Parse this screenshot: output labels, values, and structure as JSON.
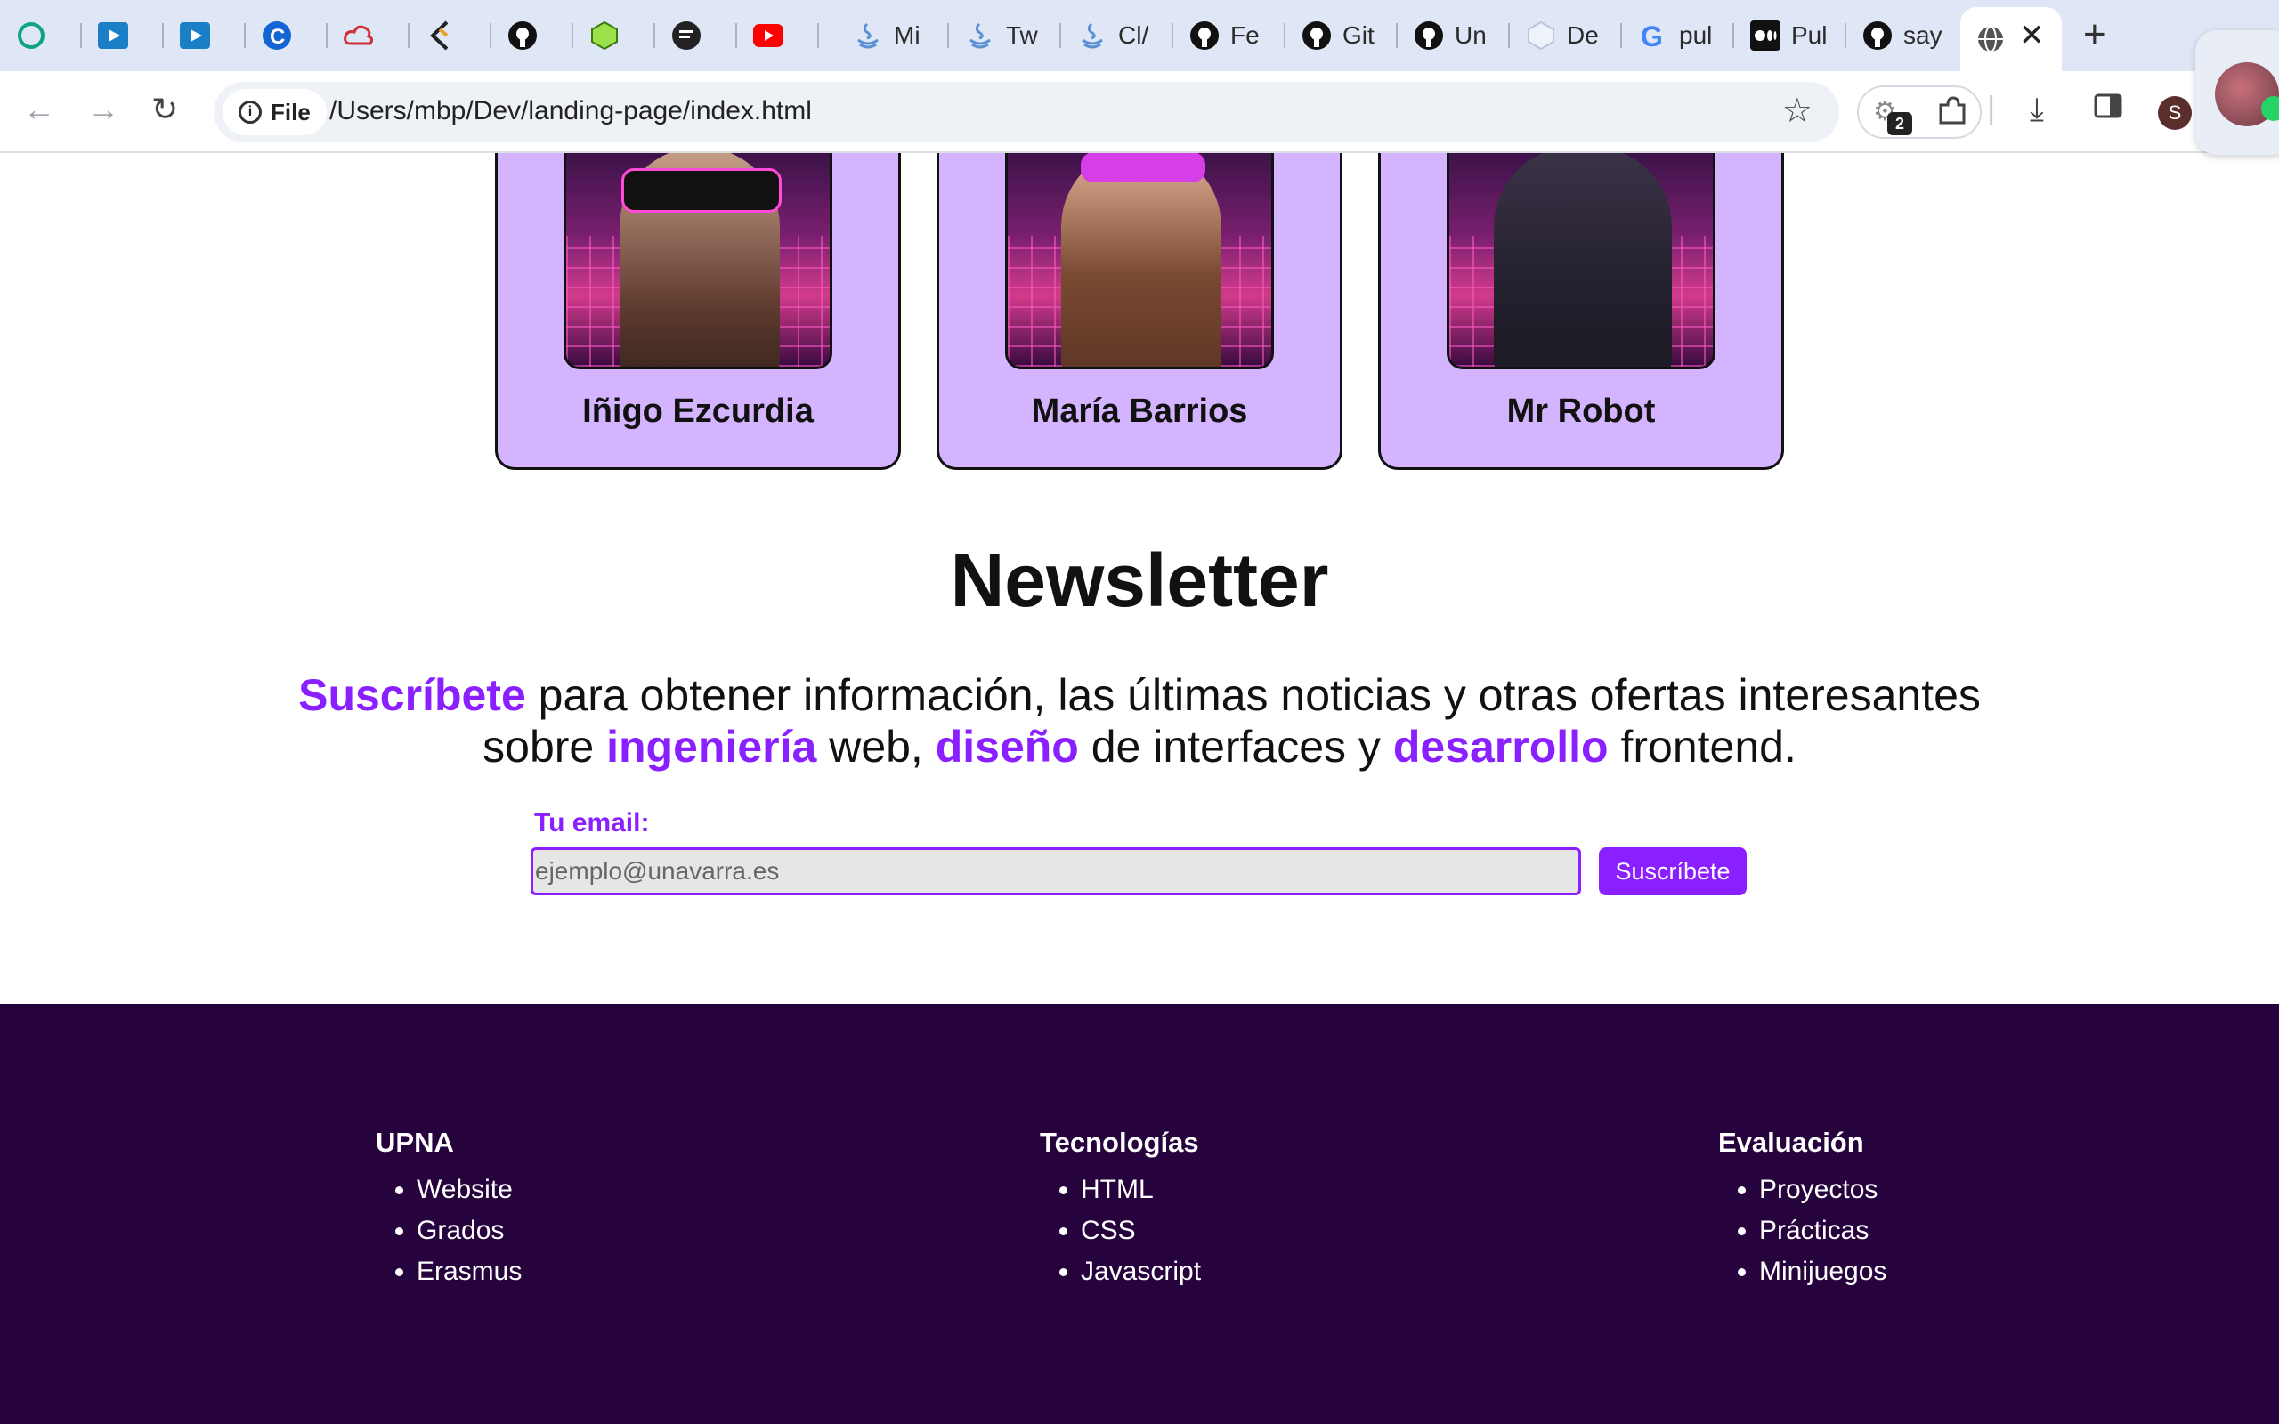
{
  "browser": {
    "tabs": [
      {
        "icon": "chatgpt-icon",
        "label": ""
      },
      {
        "icon": "video-icon",
        "label": ""
      },
      {
        "icon": "video-icon",
        "label": ""
      },
      {
        "icon": "c-logo-icon",
        "label": ""
      },
      {
        "icon": "cloud-icon",
        "label": ""
      },
      {
        "icon": "dev-icon",
        "label": ""
      },
      {
        "icon": "github-icon",
        "label": ""
      },
      {
        "icon": "cube-icon",
        "label": ""
      },
      {
        "icon": "terminal-icon",
        "label": ""
      },
      {
        "icon": "youtube-icon",
        "label": ""
      },
      {
        "icon": "java-icon",
        "label": "Mi"
      },
      {
        "icon": "java-icon",
        "label": "Tw"
      },
      {
        "icon": "java-icon",
        "label": "Cl/"
      },
      {
        "icon": "github-icon",
        "label": "Fe"
      },
      {
        "icon": "github-icon",
        "label": "Git"
      },
      {
        "icon": "github-icon",
        "label": "Un"
      },
      {
        "icon": "hexagon-icon",
        "label": "De"
      },
      {
        "icon": "google-icon",
        "label": "pul"
      },
      {
        "icon": "medium-icon",
        "label": "Pul"
      },
      {
        "icon": "github-icon",
        "label": "say"
      }
    ],
    "active_tab_icon": "globe-icon",
    "close_glyph": "✕",
    "new_tab_glyph": "+",
    "file_chip": "File",
    "url": "/Users/mbp/Dev/landing-page/index.html",
    "extensions_badge": "2",
    "profile_initial": "S"
  },
  "team": [
    {
      "name": "Iñigo Ezcurdia"
    },
    {
      "name": "María Barrios"
    },
    {
      "name": "Mr Robot"
    }
  ],
  "newsletter": {
    "title": "Newsletter",
    "desc": {
      "hl1": "Suscríbete",
      "t1": " para obtener información, las últimas noticias y otras ofertas interesantes sobre ",
      "hl2": "ingeniería",
      "t2": " web, ",
      "hl3": "diseño",
      "t3": " de interfaces y ",
      "hl4": "desarrollo",
      "t4": " frontend."
    },
    "email_label": "Tu email:",
    "email_placeholder": "ejemplo@unavarra.es",
    "button": "Suscríbete"
  },
  "footer": {
    "cols": [
      {
        "title": "UPNA",
        "items": [
          "Website",
          "Grados",
          "Erasmus"
        ]
      },
      {
        "title": "Tecnologías",
        "items": [
          "HTML",
          "CSS",
          "Javascript"
        ]
      },
      {
        "title": "Evaluación",
        "items": [
          "Proyectos",
          "Prácticas",
          "Minijuegos"
        ]
      }
    ]
  },
  "colors": {
    "accent": "#8a1fff",
    "card_bg": "#d4b3ff",
    "footer_bg": "#26033d"
  }
}
